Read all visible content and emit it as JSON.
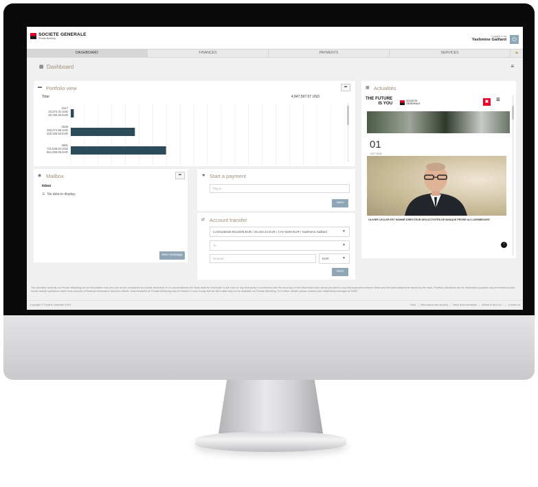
{
  "brand": {
    "name": "SOCIETE GENERALE",
    "sub": "Private Banking"
  },
  "user": {
    "logged_label": "Logged in as",
    "name": "Yashmine Gaillard"
  },
  "nav": {
    "tabs": [
      "DASHBOARD",
      "FINANCES",
      "PAYMENTS",
      "SERVICES"
    ],
    "active": "DASHBOARD"
  },
  "dashboard": {
    "title": "Dashboard"
  },
  "portfolio": {
    "title": "Portfolio view",
    "total_label": "Total",
    "total_value": "4,947,597.07 USD",
    "chart_data": {
      "type": "bar",
      "orientation": "horizontal",
      "categories": [
        "2317",
        "2538",
        "4681"
      ],
      "category_amounts": [
        [
          "23,372.31 USD",
          "20,769.46 EUR"
        ],
        [
          "492,274.59 USD",
          "429,165.53 EUR"
        ],
        [
          "731,538.64 USD",
          "651,266.05 EUR"
        ]
      ],
      "values": [
        23372.31,
        492274.59,
        731538.64
      ],
      "xlim": [
        0,
        2100000
      ],
      "grid": true
    }
  },
  "mailbox": {
    "title": "Mailbox",
    "inbox_label": "Inbox",
    "no_data": "No data to display.",
    "new_message_button": "New message"
  },
  "payment": {
    "title": "Start a payment",
    "pay_to_placeholder": "Pay to",
    "next_button": "Next"
  },
  "transfer": {
    "title": "Account transfer",
    "from_value": "LU1012561B-0013200-EUR / 26.423.24 EUR / CAV-3200-EUR / Yashmine Gaillard",
    "to_placeholder": "To",
    "amount_placeholder": "Amount",
    "currency": "EUR",
    "next_button": "Next"
  },
  "news": {
    "title": "Actualités",
    "tagline_1": "THE FUTURE",
    "tagline_2": "IS YOU",
    "brand_line_1": "SOCIETE",
    "brand_line_2": "GENERALE",
    "date_day": "01",
    "date_month": "OCT 2019",
    "caption": "OLIVIER LECLER EST NOMMÉ DIRECTEUR DES ACTIVITÉS DE BANQUE PRIVÉE AU LUXEMBOURG"
  },
  "disclaimer": "The provided contents via Private eBanking are for information only and can not be considered as a bank statement. In no circumstances the Bank shall be held liable to the User or any third party in connection with the accuracy of the information here above provided or any discrepancies between these and the bank statements issued by the bank. Portfolio valuations are for information purpose only and based on last known market quotations taken from sources of financial information deemed reliable. Data available on Private eBanking may be limited, in such a way that all client data may not be available via Private eBanking. For further details, please contact your relationship manager at SGBT.",
  "footer": {
    "copyright": "Copyright © Societe Generale 2019",
    "links": [
      "Help",
      "Information and security",
      "Bank documentation",
      "Where to find us ?",
      "Contact us"
    ]
  },
  "colors": {
    "accent": "#a08c73",
    "bar": "#2b4a5a",
    "button": "#8fa6b6",
    "brand_red": "#e60028"
  },
  "icons": {
    "dashboard": "grid-icon",
    "portfolio": "briefcase-icon",
    "mailbox": "eye-icon",
    "payment": "hand-icon",
    "transfer": "transfer-icon",
    "news": "grid-icon",
    "share": "share-arrow-icon",
    "power": "power-icon",
    "star": "star-icon",
    "menu": "hamburger-icon"
  }
}
